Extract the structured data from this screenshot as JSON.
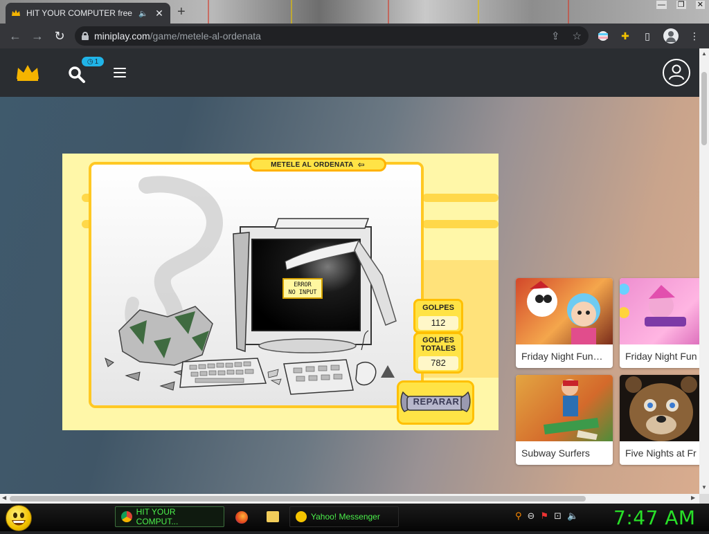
{
  "browser": {
    "tab_title": "HIT YOUR COMPUTER free o",
    "tab_audio_icon": "speaker-icon",
    "tab_close": "✕",
    "new_tab": "+",
    "window_controls": [
      "—",
      "❐",
      "✕"
    ],
    "url_host": "miniplay.com",
    "url_path": "/game/metele-al-ordenata"
  },
  "site": {
    "search_badge": "1",
    "accent": "#20b4e8",
    "header_bg": "#2a2d31"
  },
  "game": {
    "title": "METELE AL ORDENATA",
    "screen_text_line1": "ERROR",
    "screen_text_line2": "NO INPUT",
    "golpes_label": "GOLPES",
    "golpes_value": "112",
    "golpes_totales_label_line1": "GOLPES",
    "golpes_totales_label_line2": "TOTALES",
    "golpes_totales_value": "782",
    "repair_label": "REPARAR"
  },
  "related_games": [
    {
      "title": "Friday Night Fun…"
    },
    {
      "title": "Friday Night Fun"
    },
    {
      "title": "Subway Surfers"
    },
    {
      "title": "Five Nights at Fr"
    }
  ],
  "taskbar": {
    "chrome_task": "HIT YOUR COMPUT...",
    "yahoo_task": "Yahoo! Messenger",
    "clock": "7:47 AM"
  }
}
